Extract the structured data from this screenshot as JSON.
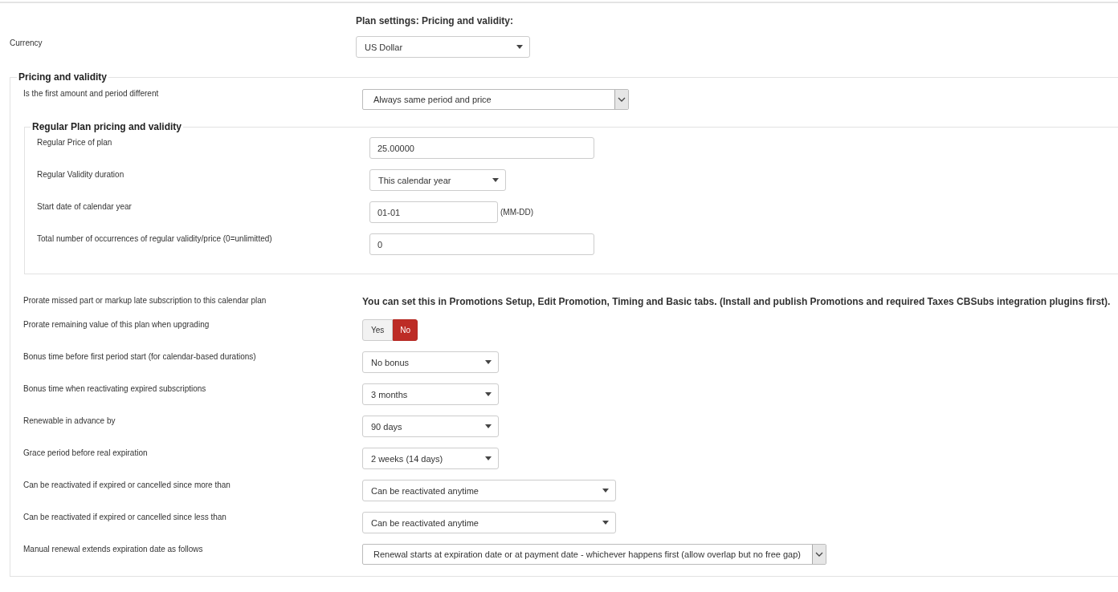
{
  "heading": "Plan settings: Pricing and validity:",
  "currency": {
    "label": "Currency",
    "value": "US Dollar"
  },
  "pricing": {
    "legend": "Pricing and validity",
    "first_row": {
      "label": "Is the first amount and period different",
      "kind": "native_select",
      "value": "Always same period and price"
    },
    "regular": {
      "legend": "Regular Plan pricing and validity",
      "rows": [
        {
          "label": "Regular Price of plan",
          "kind": "text",
          "value": "25.00000"
        },
        {
          "label": "Regular Validity duration",
          "kind": "select",
          "value": "This calendar year"
        },
        {
          "label": "Start date of calendar year",
          "kind": "date",
          "value": "01-01",
          "suffix": "(MM-DD)"
        },
        {
          "label": "Total number of occurrences of regular validity/price (0=unlimitted)",
          "kind": "text",
          "value": "0"
        }
      ]
    },
    "rows": [
      {
        "label": "Prorate missed part or markup late subscription to this calendar plan",
        "kind": "note",
        "value": "You can set this in Promotions Setup, Edit Promotion, Timing and Basic tabs. (Install and publish Promotions and required Taxes CBSubs integration plugins first)."
      },
      {
        "label": "Prorate remaining value of this plan when upgrading",
        "kind": "toggle",
        "options": [
          {
            "label": "Yes",
            "selected": false
          },
          {
            "label": "No",
            "selected": true
          }
        ]
      },
      {
        "label": "Bonus time before first period start (for calendar-based durations)",
        "kind": "select",
        "value": "No bonus"
      },
      {
        "label": "Bonus time when reactivating expired subscriptions",
        "kind": "select",
        "value": "3 months"
      },
      {
        "label": "Renewable in advance by",
        "kind": "select",
        "value": "90 days"
      },
      {
        "label": "Grace period before real expiration",
        "kind": "select",
        "value": "2 weeks (14 days)"
      },
      {
        "label": "Can be reactivated if expired or cancelled since more than",
        "kind": "select",
        "value": "Can be reactivated anytime"
      },
      {
        "label": "Can be reactivated if expired or cancelled since less than",
        "kind": "select",
        "value": "Can be reactivated anytime"
      },
      {
        "label": "Manual renewal extends expiration date as follows",
        "kind": "native_select",
        "value": "Renewal starts at expiration date or at payment date - whichever happens first (allow overlap but no free gap)"
      }
    ]
  }
}
